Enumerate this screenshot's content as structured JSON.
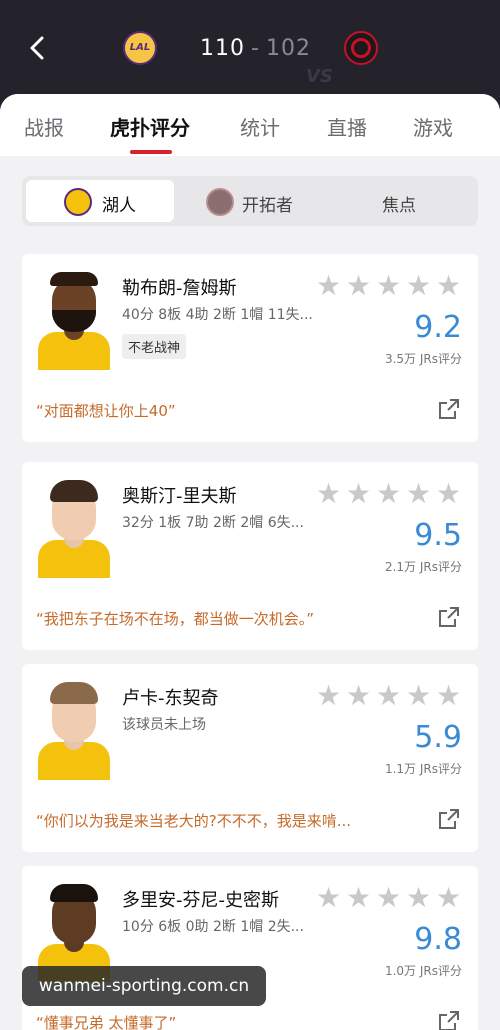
{
  "header": {
    "home_score": "110",
    "separator": "-",
    "away_score": "102",
    "home_logo_text": "LAL",
    "vs_text": "VS"
  },
  "tabs": [
    {
      "label": "战报"
    },
    {
      "label": "虎扑评分"
    },
    {
      "label": "统计"
    },
    {
      "label": "直播"
    },
    {
      "label": "游戏"
    }
  ],
  "segments": [
    {
      "label": "湖人"
    },
    {
      "label": "开拓者"
    },
    {
      "label": "焦点"
    }
  ],
  "players": [
    {
      "name": "勒布朗-詹姆斯",
      "stats": "40分 8板 4助 2断 1帽 11失...",
      "tag": "不老战神",
      "rating": "9.2",
      "votes": "3.5万 JRs评分",
      "quote": "“对面都想让你上40”"
    },
    {
      "name": "奥斯汀-里夫斯",
      "stats": "32分 1板 7助 2断 2帽 6失...",
      "tag": "",
      "rating": "9.5",
      "votes": "2.1万 JRs评分",
      "quote": "“我把东子在场不在场，都当做一次机会。”"
    },
    {
      "name": "卢卡-东契奇",
      "stats": "该球员未上场",
      "tag": "",
      "rating": "5.9",
      "votes": "1.1万 JRs评分",
      "quote": "“你们以为我是来当老大的?不不不，我是来啃..."
    },
    {
      "name": "多里安-芬尼-史密斯",
      "stats": "10分 6板 0助 2断 1帽 2失...",
      "tag": "",
      "rating": "9.8",
      "votes": "1.0万 JRs评分",
      "quote": "“懂事兄弟 太懂事了”"
    }
  ],
  "watermark": "wanmei-sporting.com.cn",
  "colors": {
    "accent": "#d6232d",
    "rating_blue": "#3a8ad4",
    "quote_orange": "#c66a2a",
    "lakers_gold": "#f4c20d",
    "lakers_purple": "#5a2a7c",
    "header_bg": "#24232c"
  },
  "icons": {
    "back": "back-arrow-icon",
    "star": "star-icon",
    "share": "share-icon"
  }
}
